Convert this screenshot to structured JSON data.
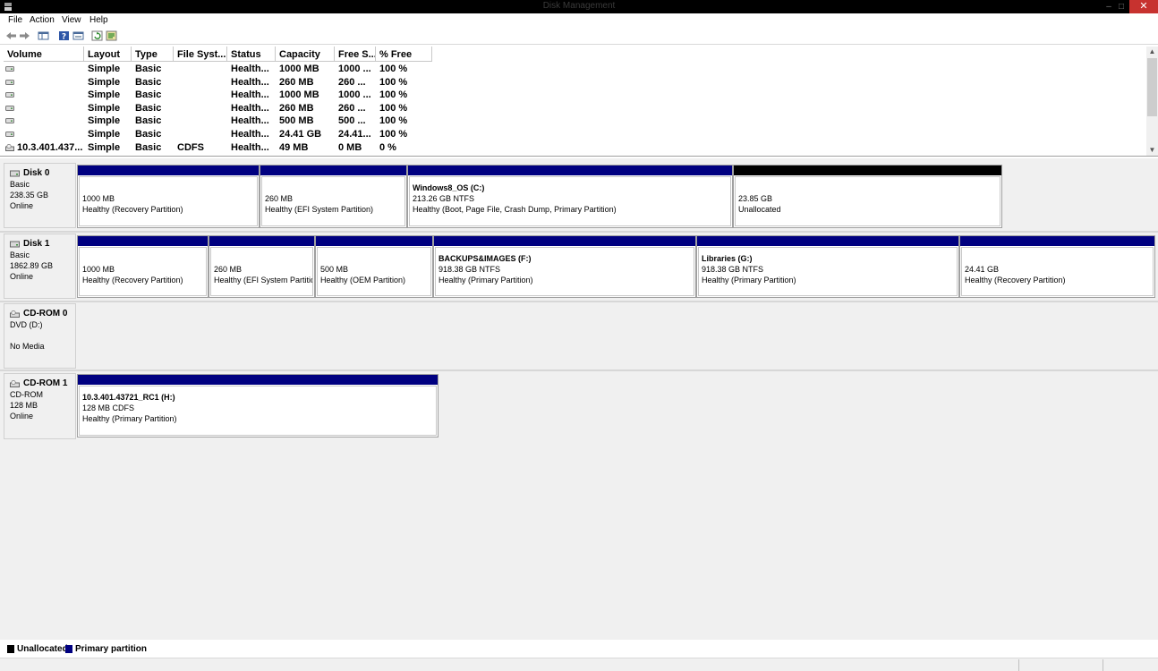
{
  "window": {
    "title": "Disk Management",
    "minimize": "–",
    "maximize": "□",
    "close": "✕"
  },
  "menu": [
    "File",
    "Action",
    "View",
    "Help"
  ],
  "toolbar": [
    "back-icon",
    "forward-icon",
    "show-hide-console-tree-icon",
    "help-icon",
    "properties-icon",
    "refresh-icon",
    "export-list-icon"
  ],
  "volume_list": {
    "columns": [
      "Volume",
      "Layout",
      "Type",
      "File Syst...",
      "Status",
      "Capacity",
      "Free S...",
      "% Free"
    ],
    "rows": [
      [
        "",
        "Simple",
        "Basic",
        "",
        "Health...",
        "1000 MB",
        "1000 ...",
        "100 %"
      ],
      [
        "",
        "Simple",
        "Basic",
        "",
        "Health...",
        "260 MB",
        "260 ...",
        "100 %"
      ],
      [
        "",
        "Simple",
        "Basic",
        "",
        "Health...",
        "1000 MB",
        "1000 ...",
        "100 %"
      ],
      [
        "",
        "Simple",
        "Basic",
        "",
        "Health...",
        "260 MB",
        "260 ...",
        "100 %"
      ],
      [
        "",
        "Simple",
        "Basic",
        "",
        "Health...",
        "500 MB",
        "500 ...",
        "100 %"
      ],
      [
        "",
        "Simple",
        "Basic",
        "",
        "Health...",
        "24.41 GB",
        "24.41...",
        "100 %"
      ],
      [
        "10.3.401.437...",
        "Simple",
        "Basic",
        "CDFS",
        "Health...",
        "49 MB",
        "0 MB",
        "0 %"
      ]
    ]
  },
  "disks": [
    {
      "name": "Disk 0",
      "info": [
        "Basic",
        "238.35 GB",
        "Online"
      ],
      "partitions": [
        {
          "name": "",
          "size": "1000 MB",
          "status": "Healthy (Recovery Partition)",
          "kind": "primary"
        },
        {
          "name": "",
          "size": "260 MB",
          "status": "Healthy (EFI System Partition)",
          "kind": "primary"
        },
        {
          "name": "Windows8_OS  (C:)",
          "size": "213.26 GB NTFS",
          "status": "Healthy (Boot, Page File, Crash Dump, Primary Partition)",
          "kind": "primary"
        },
        {
          "name": "",
          "size": "23.85 GB",
          "status": "Unallocated",
          "kind": "unallocated"
        }
      ]
    },
    {
      "name": "Disk 1",
      "info": [
        "Basic",
        "1862.89 GB",
        "Online"
      ],
      "partitions": [
        {
          "name": "",
          "size": "1000 MB",
          "status": "Healthy (Recovery Partition)",
          "kind": "primary"
        },
        {
          "name": "",
          "size": "260 MB",
          "status": "Healthy (EFI System Partitic",
          "kind": "primary"
        },
        {
          "name": "",
          "size": "500 MB",
          "status": "Healthy (OEM Partition)",
          "kind": "primary"
        },
        {
          "name": "BACKUPS&IMAGES  (F:)",
          "size": "918.38 GB NTFS",
          "status": "Healthy (Primary Partition)",
          "kind": "primary"
        },
        {
          "name": "Libraries  (G:)",
          "size": "918.38 GB NTFS",
          "status": "Healthy (Primary Partition)",
          "kind": "primary"
        },
        {
          "name": "",
          "size": "24.41 GB",
          "status": "Healthy (Recovery Partition)",
          "kind": "primary"
        }
      ]
    },
    {
      "name": "CD-ROM 0",
      "info": [
        "DVD (D:)",
        "",
        "No Media"
      ],
      "partitions": []
    },
    {
      "name": "CD-ROM 1",
      "info": [
        "CD-ROM",
        "128 MB",
        "Online"
      ],
      "partitions": [
        {
          "name": "10.3.401.43721_RC1  (H:)",
          "size": "128 MB CDFS",
          "status": "Healthy (Primary Partition)",
          "kind": "primary"
        }
      ]
    }
  ],
  "legend": [
    {
      "label": "Unallocated",
      "color": "#000000"
    },
    {
      "label": "Primary partition",
      "color": "#000080"
    }
  ]
}
